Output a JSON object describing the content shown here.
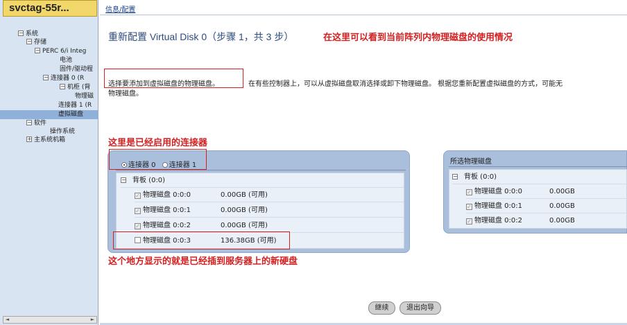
{
  "sidebar": {
    "host": "svctag-55r...",
    "tree": [
      {
        "label": "系统",
        "box": "−"
      },
      {
        "label": "存储",
        "box": "−"
      },
      {
        "label": "PERC 6/i Integ",
        "box": "−"
      },
      {
        "label": "电池",
        "box": ""
      },
      {
        "label": "固件/驱动程",
        "box": ""
      },
      {
        "label": "连接器 0 (R",
        "box": "−"
      },
      {
        "label": "机柜 (背",
        "box": "−"
      },
      {
        "label": "物理磁",
        "box": ""
      },
      {
        "label": "连接器 1 (R",
        "box": ""
      },
      {
        "label": "虚拟磁盘",
        "box": ""
      },
      {
        "label": "软件",
        "box": "−"
      },
      {
        "label": "操作系统",
        "box": ""
      },
      {
        "label": "主系统机箱",
        "box": "+"
      }
    ],
    "scroll_left": "◄",
    "scroll_right": "►"
  },
  "breadcrumb": "信息/配置",
  "page": {
    "title": "重新配置 Virtual Disk 0（步骤 1，共 3 步）",
    "note_top": "在这里可以看到当前阵列内物理磁盘的使用情况",
    "instruction": "选择要添加到虚拟磁盘的物理磁盘。",
    "description": "在有些控制器上，可以从虚拟磁盘取消选择或卸下物理磁盘。 根据您重新配置虚拟磁盘的方式，可能无",
    "description_cont": "物理磁盘。",
    "note_connectors": "这里是已经启用的连接器",
    "note_new_disk": "这个地方显示的就是已经插到服务器上的新硬盘"
  },
  "connectors": {
    "options": [
      "连接器 0",
      "连接器 1"
    ],
    "selected": 0,
    "backplane": "背板 (0:0)",
    "disks": [
      {
        "name": "物理磁盘 0:0:0",
        "size": "0.00GB (可用)",
        "checked": true,
        "disabled": true
      },
      {
        "name": "物理磁盘 0:0:1",
        "size": "0.00GB (可用)",
        "checked": true,
        "disabled": true
      },
      {
        "name": "物理磁盘 0:0:2",
        "size": "0.00GB (可用)",
        "checked": true,
        "disabled": true
      },
      {
        "name": "物理磁盘 0:0:3",
        "size": "136.38GB (可用)",
        "checked": false,
        "disabled": false
      }
    ]
  },
  "selected_disks": {
    "title": "所选物理磁盘",
    "backplane": "背板 (0:0)",
    "disks": [
      {
        "name": "物理磁盘 0:0:0",
        "size": "0.00GB"
      },
      {
        "name": "物理磁盘 0:0:1",
        "size": "0.00GB"
      },
      {
        "name": "物理磁盘 0:0:2",
        "size": "0.00GB"
      }
    ]
  },
  "buttons": {
    "continue": "继续",
    "exit": "退出向导"
  },
  "colors": {
    "accent_red": "#d42020",
    "panel": "#a9bfdc",
    "host_bg": "#f2d86a"
  }
}
